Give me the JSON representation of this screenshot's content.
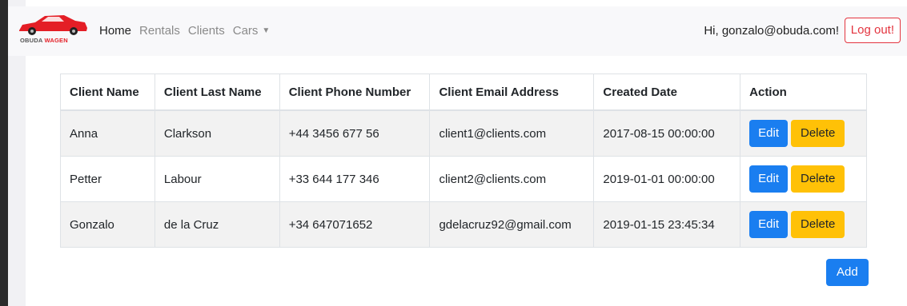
{
  "brand": {
    "part1": "OBUDA",
    "part2": "WAGEN",
    "car_color": "#e41e26"
  },
  "nav": {
    "items": [
      {
        "label": "Home",
        "active": true
      },
      {
        "label": "Rentals",
        "active": false
      },
      {
        "label": "Clients",
        "active": false
      },
      {
        "label": "Cars",
        "active": false,
        "dropdown": true
      }
    ],
    "caret_icon": "caret-down-icon",
    "greeting": "Hi, gonzalo@obuda.com!",
    "logout_label": "Log out!"
  },
  "table": {
    "headers": [
      "Client Name",
      "Client Last Name",
      "Client Phone Number",
      "Client Email Address",
      "Created Date",
      "Action"
    ],
    "rows": [
      {
        "name": "Anna",
        "last_name": "Clarkson",
        "phone": "+44 3456 677 56",
        "email": "client1@clients.com",
        "created": "2017-08-15 00:00:00"
      },
      {
        "name": "Petter",
        "last_name": "Labour",
        "phone": "+33 644 177 346",
        "email": "client2@clients.com",
        "created": "2019-01-01 00:00:00"
      },
      {
        "name": "Gonzalo",
        "last_name": "de la Cruz",
        "phone": "+34 647071652",
        "email": "gdelacruz92@gmail.com",
        "created": "2019-01-15 23:45:34"
      }
    ],
    "edit_label": "Edit",
    "delete_label": "Delete"
  },
  "add_label": "Add",
  "colors": {
    "primary": "#1a7ef0",
    "warning": "#ffc107",
    "danger": "#e3343f"
  }
}
